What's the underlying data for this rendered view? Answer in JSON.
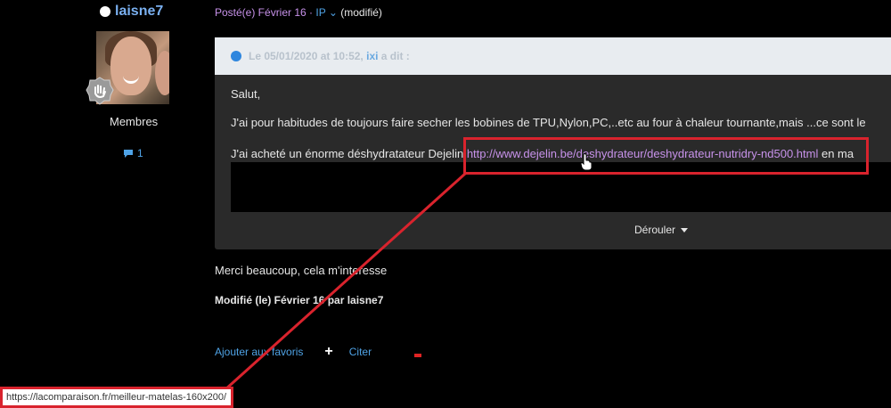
{
  "author": {
    "name": "laisne7",
    "role": "Membres",
    "comment_count": "1",
    "online_icon": "online-dot-icon",
    "badge_icon": "hand-wave-badge-icon",
    "comment_icon": "speech-bubble-icon"
  },
  "post": {
    "posted_label": "Posté(e) Février 16",
    "separator": " · ",
    "ip_label": "IP",
    "modified_label": "(modifié)"
  },
  "quote": {
    "header_date": "Le 05/01/2020 at 10:52,",
    "header_user": "ixi",
    "header_said": "a dit :",
    "line1": "Salut,",
    "line2": "J'ai pour habitudes de toujours faire secher les bobines de TPU,Nylon,PC,..etc au four à chaleur tournante,mais ...ce sont le",
    "line3_prefix": "J'ai acheté un énorme déshydratateur Dejelin ",
    "line3_link": "http://www.dejelin.be/deshydrateur/deshydrateur-nutridry-nd500.html",
    "line3_suffix": " en ma",
    "expand_label": "Dérouler"
  },
  "reply": {
    "text": "Merci beaucoup, cela m'interesse",
    "edited_note": "Modifié (le) Février 16 par laisne7"
  },
  "actions": {
    "favorite_label": "Ajouter aux favoris",
    "plus_label": "+",
    "quote_label": "Citer"
  },
  "statusbar": {
    "url": "https://lacomparaison.fr/meilleur-matelas-160x200/"
  },
  "colors": {
    "background": "#000000",
    "link_blue": "#4fa3e6",
    "link_purple": "#c792ea",
    "annotation_red": "#d9232d"
  }
}
